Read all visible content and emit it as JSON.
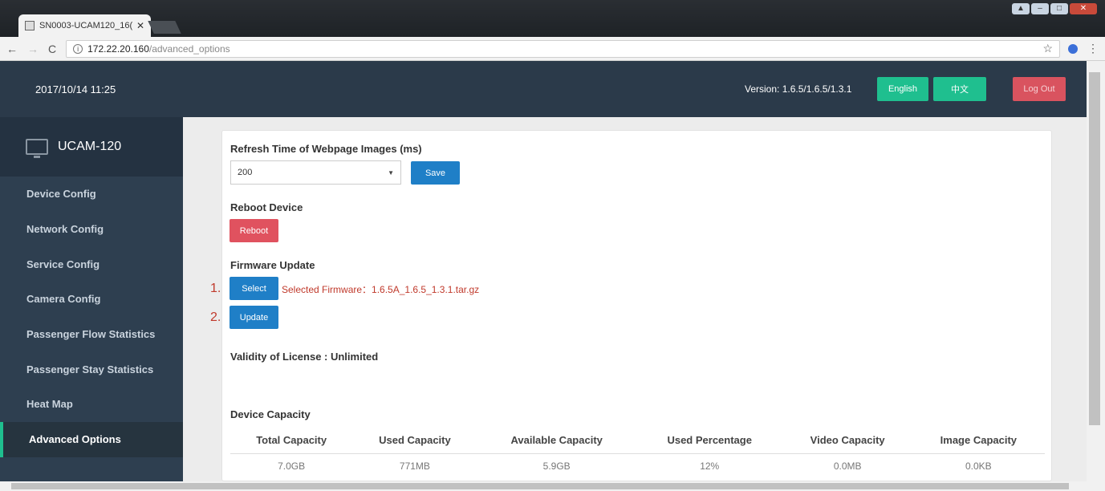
{
  "browser": {
    "tab_title": "SN0003-UCAM120_16(",
    "tab_close": "✕",
    "url_host": "172.22.20.160",
    "url_path": "/advanced_options",
    "back": "←",
    "forward": "→",
    "reload": "C",
    "star": "☆",
    "menu": "⋮"
  },
  "header": {
    "datetime": "2017/10/14 11:25",
    "version": "Version: 1.6.5/1.6.5/1.3.1",
    "english_label": "English",
    "chinese_label": "中文",
    "logout_label": "Log Out"
  },
  "sidebar": {
    "brand": "UCAM-120",
    "items": [
      {
        "label": "Device Config"
      },
      {
        "label": "Network Config"
      },
      {
        "label": "Service Config"
      },
      {
        "label": "Camera Config"
      },
      {
        "label": "Passenger Flow Statistics"
      },
      {
        "label": "Passenger Stay Statistics"
      },
      {
        "label": "Heat Map"
      },
      {
        "label": "Advanced Options"
      }
    ]
  },
  "main": {
    "refresh_title": "Refresh Time of Webpage Images (ms)",
    "refresh_value": "200",
    "save_label": "Save",
    "reboot_title": "Reboot Device",
    "reboot_label": "Reboot",
    "firmware_title": "Firmware Update",
    "step1": "1.",
    "step2": "2.",
    "select_label": "Select",
    "selected_firmware": "Selected Firmware：1.6.5A_1.6.5_1.3.1.tar.gz",
    "update_label": "Update",
    "license": "Validity of License : Unlimited",
    "capacity_title": "Device Capacity",
    "capacity_headers": [
      "Total Capacity",
      "Used Capacity",
      "Available Capacity",
      "Used Percentage",
      "Video Capacity",
      "Image Capacity"
    ],
    "capacity_values": [
      "7.0GB",
      "771MB",
      "5.9GB",
      "12%",
      "0.0MB",
      "0.0KB"
    ]
  }
}
